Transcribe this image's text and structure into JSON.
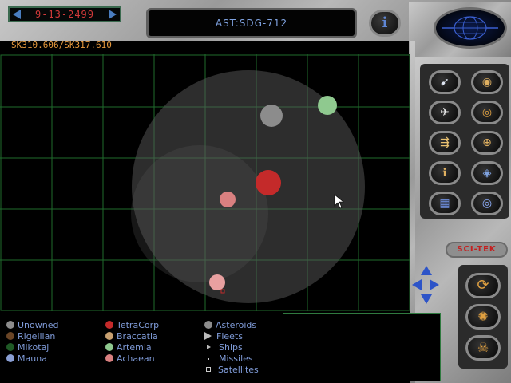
{
  "date": "9-13-2499",
  "target": "AST:SDG-712",
  "info_label": "i",
  "sector": "SK310.606/SK317.610",
  "brand": "SCI-TEK",
  "colors": {
    "grid": "#1f6b2c",
    "unowned": "#8c8c8c",
    "rigellian": "#6a4526",
    "mikotaj": "#1f5a26",
    "mauna": "#8a9fd4",
    "tetracorp": "#c42a2a",
    "braccatia": "#c8a070",
    "artemia": "#8fc98f",
    "achaean": "#d98080",
    "asteroids": "#8c8c8c",
    "legend_text": "#7f9bd8"
  },
  "legend": {
    "col1": [
      {
        "label": "Unowned",
        "color": "#8c8c8c"
      },
      {
        "label": "Rigellian",
        "color": "#6a4526"
      },
      {
        "label": "Mikotaj",
        "color": "#1f5a26"
      },
      {
        "label": "Mauna",
        "color": "#8a9fd4"
      }
    ],
    "col2": [
      {
        "label": "TetraCorp",
        "color": "#c42a2a"
      },
      {
        "label": "Braccatia",
        "color": "#c8a070"
      },
      {
        "label": "Artemia",
        "color": "#8fc98f"
      },
      {
        "label": "Achaean",
        "color": "#d98080"
      }
    ],
    "col3": [
      {
        "label": "Asteroids",
        "marker": "circle"
      },
      {
        "label": "Fleets",
        "marker": "triangle"
      },
      {
        "label": "Ships",
        "marker": "small-triangle"
      },
      {
        "label": "Missiles",
        "marker": "dot"
      },
      {
        "label": "Satellites",
        "marker": "square"
      }
    ]
  },
  "map_objects": [
    {
      "type": "asteroid",
      "owner": "Unowned",
      "color": "#8c8c8c"
    },
    {
      "type": "asteroid",
      "owner": "Artemia",
      "color": "#8fc98f"
    },
    {
      "type": "asteroid",
      "owner": "TetraCorp",
      "color": "#c42a2a"
    },
    {
      "type": "asteroid",
      "owner": "Achaean",
      "color": "#d98080"
    },
    {
      "type": "asteroid",
      "owner": "Achaean",
      "color": "#e8a0a0"
    }
  ],
  "side_buttons": [
    {
      "name": "laser-attack-icon",
      "glyph": "➹",
      "color": "#dfe6f2"
    },
    {
      "name": "planet-eye-icon",
      "glyph": "◉",
      "color": "#e0b060"
    },
    {
      "name": "ship-icon",
      "glyph": "✈",
      "color": "#e8e8e8"
    },
    {
      "name": "target-scope-icon",
      "glyph": "◎",
      "color": "#e0a040"
    },
    {
      "name": "fleet-to-planet-icon",
      "glyph": "⇶",
      "color": "#e8c070"
    },
    {
      "name": "fleet-target-icon",
      "glyph": "⊕",
      "color": "#e0b060"
    },
    {
      "name": "info-planet-icon",
      "glyph": "ℹ",
      "color": "#e0b060"
    },
    {
      "name": "diamond-icon",
      "glyph": "◈",
      "color": "#7fa2e0"
    },
    {
      "name": "grid-icon",
      "glyph": "▦",
      "color": "#6f8fe0"
    },
    {
      "name": "eye-icon",
      "glyph": "◎",
      "color": "#8fb0ff"
    },
    {
      "name": "rotate-icon",
      "glyph": "⟳",
      "color": "#e0a040"
    },
    {
      "name": "orbit-icon",
      "glyph": "✺",
      "color": "#e0a040"
    },
    {
      "name": "skull-icon",
      "glyph": "☠",
      "color": "#e0a040"
    }
  ]
}
